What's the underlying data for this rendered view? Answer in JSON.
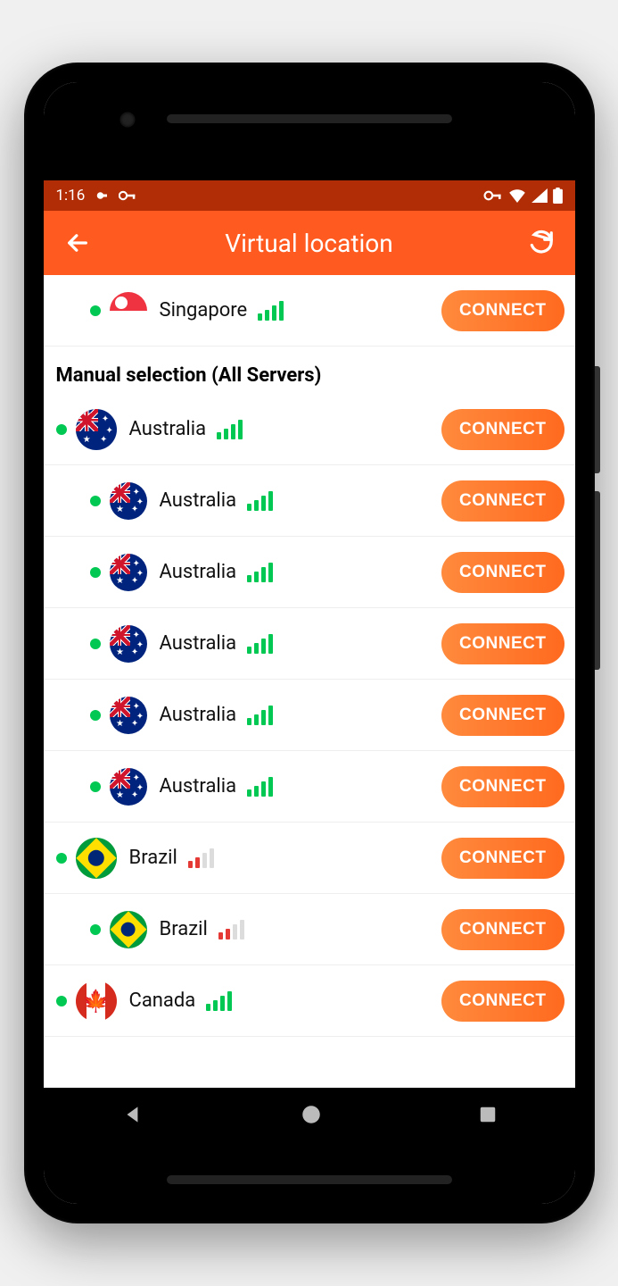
{
  "status": {
    "time": "1:16"
  },
  "appbar": {
    "title": "Virtual location"
  },
  "connect_label": "CONNECT",
  "section_header": "Manual selection (All Servers)",
  "servers": [
    {
      "name": "Singapore",
      "flag": "sg",
      "signal": 4,
      "signal_color": "green",
      "parent": false,
      "child": true
    },
    {
      "header": true
    },
    {
      "name": "Australia",
      "flag": "au",
      "signal": 4,
      "signal_color": "green",
      "parent": true,
      "child": false
    },
    {
      "name": "Australia",
      "flag": "au",
      "signal": 4,
      "signal_color": "green",
      "parent": false,
      "child": true
    },
    {
      "name": "Australia",
      "flag": "au",
      "signal": 4,
      "signal_color": "green",
      "parent": false,
      "child": true
    },
    {
      "name": "Australia",
      "flag": "au",
      "signal": 4,
      "signal_color": "green",
      "parent": false,
      "child": true
    },
    {
      "name": "Australia",
      "flag": "au",
      "signal": 4,
      "signal_color": "green",
      "parent": false,
      "child": true
    },
    {
      "name": "Australia",
      "flag": "au",
      "signal": 4,
      "signal_color": "green",
      "parent": false,
      "child": true
    },
    {
      "name": "Brazil",
      "flag": "br",
      "signal": 2,
      "signal_color": "red",
      "parent": true,
      "child": false
    },
    {
      "name": "Brazil",
      "flag": "br",
      "signal": 2,
      "signal_color": "red",
      "parent": false,
      "child": true
    },
    {
      "name": "Canada",
      "flag": "ca",
      "signal": 4,
      "signal_color": "green",
      "parent": true,
      "child": false
    }
  ]
}
